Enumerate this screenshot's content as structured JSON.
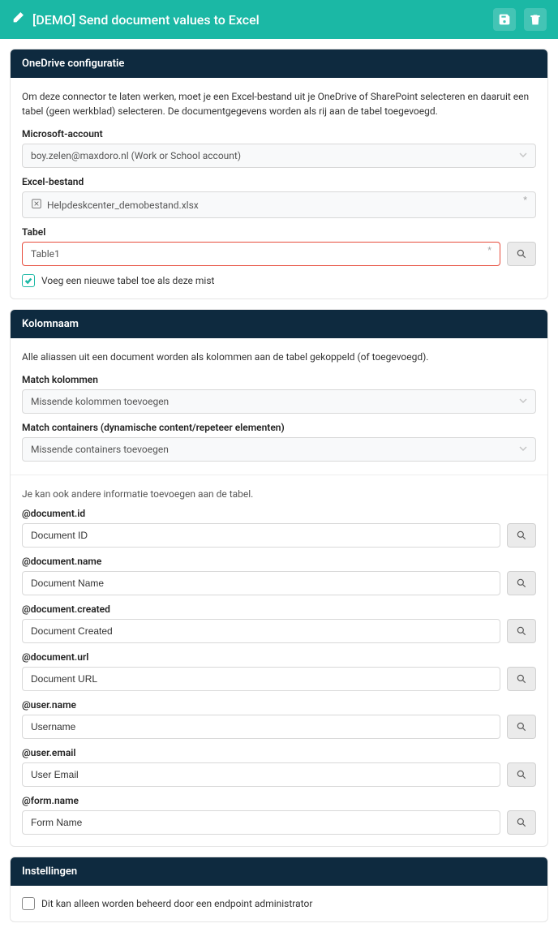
{
  "header": {
    "title": "[DEMO] Send document values to Excel"
  },
  "sections": {
    "onedrive": {
      "title": "OneDrive configuratie",
      "description": "Om deze connector te laten werken, moet je een Excel-bestand uit je OneDrive of SharePoint selecteren en daaruit een tabel (geen werkblad) selecteren. De documentgegevens worden als rij aan de tabel toegevoegd.",
      "account_label": "Microsoft-account",
      "account_value": "boy.zelen@maxdoro.nl (Work or School account)",
      "file_label": "Excel-bestand",
      "file_value": "Helpdeskcenter_demobestand.xlsx",
      "table_label": "Tabel",
      "table_value": "Table1",
      "add_table_checkbox": "Voeg een nieuwe tabel toe als deze mist"
    },
    "columns": {
      "title": "Kolomnaam",
      "description": "Alle aliassen uit een document worden als kolommen aan de tabel gekoppeld (of toegevoegd).",
      "match_cols_label": "Match kolommen",
      "match_cols_value": "Missende kolommen toevoegen",
      "match_containers_label": "Match containers (dynamische content/repeteer elementen)",
      "match_containers_value": "Missende containers toevoegen",
      "extra_info_text": "Je kan ook andere informatie toevoegen aan de tabel.",
      "fields": [
        {
          "label": "@document.id",
          "value": "Document ID"
        },
        {
          "label": "@document.name",
          "value": "Document Name"
        },
        {
          "label": "@document.created",
          "value": "Document Created"
        },
        {
          "label": "@document.url",
          "value": "Document URL"
        },
        {
          "label": "@user.name",
          "value": "Username"
        },
        {
          "label": "@user.email",
          "value": "User Email"
        },
        {
          "label": "@form.name",
          "value": "Form Name"
        }
      ]
    },
    "settings": {
      "title": "Instellingen",
      "admin_only_label": "Dit kan alleen worden beheerd door een endpoint administrator"
    }
  }
}
